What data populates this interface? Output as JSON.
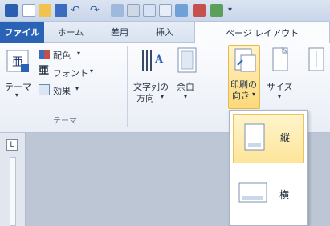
{
  "ribbon_tabs": [
    {
      "label": "ファイル"
    },
    {
      "label": "ホーム"
    },
    {
      "label": "差用"
    },
    {
      "label": "挿入"
    },
    {
      "label": "ページ レイアウト"
    }
  ],
  "theme_group": {
    "themes_label": "テーマ",
    "colors_label": "配色",
    "fonts_label": "フォント",
    "effects_label": "効果",
    "title": "テーマ"
  },
  "page_setup": {
    "text_direction_line1": "文字列の",
    "text_direction_line2": "方向",
    "margins_label": "余白",
    "orientation_line1": "印刷の",
    "orientation_line2": "向き",
    "size_label": "サイズ"
  },
  "orientation_menu": {
    "items": [
      {
        "label": "縦",
        "selected": true
      },
      {
        "label": "横",
        "selected": false
      }
    ]
  },
  "colors": {
    "file_tab": "#2a63b6",
    "highlight": "#fde59a",
    "highlight_border": "#efc35a"
  }
}
